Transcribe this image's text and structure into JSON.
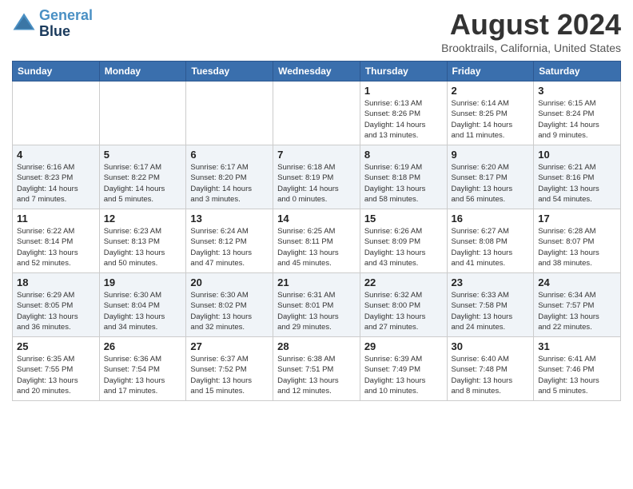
{
  "header": {
    "logo_line1": "General",
    "logo_line2": "Blue",
    "main_title": "August 2024",
    "subtitle": "Brooktrails, California, United States"
  },
  "weekdays": [
    "Sunday",
    "Monday",
    "Tuesday",
    "Wednesday",
    "Thursday",
    "Friday",
    "Saturday"
  ],
  "weeks": [
    [
      {
        "day": "",
        "info": ""
      },
      {
        "day": "",
        "info": ""
      },
      {
        "day": "",
        "info": ""
      },
      {
        "day": "",
        "info": ""
      },
      {
        "day": "1",
        "info": "Sunrise: 6:13 AM\nSunset: 8:26 PM\nDaylight: 14 hours\nand 13 minutes."
      },
      {
        "day": "2",
        "info": "Sunrise: 6:14 AM\nSunset: 8:25 PM\nDaylight: 14 hours\nand 11 minutes."
      },
      {
        "day": "3",
        "info": "Sunrise: 6:15 AM\nSunset: 8:24 PM\nDaylight: 14 hours\nand 9 minutes."
      }
    ],
    [
      {
        "day": "4",
        "info": "Sunrise: 6:16 AM\nSunset: 8:23 PM\nDaylight: 14 hours\nand 7 minutes."
      },
      {
        "day": "5",
        "info": "Sunrise: 6:17 AM\nSunset: 8:22 PM\nDaylight: 14 hours\nand 5 minutes."
      },
      {
        "day": "6",
        "info": "Sunrise: 6:17 AM\nSunset: 8:20 PM\nDaylight: 14 hours\nand 3 minutes."
      },
      {
        "day": "7",
        "info": "Sunrise: 6:18 AM\nSunset: 8:19 PM\nDaylight: 14 hours\nand 0 minutes."
      },
      {
        "day": "8",
        "info": "Sunrise: 6:19 AM\nSunset: 8:18 PM\nDaylight: 13 hours\nand 58 minutes."
      },
      {
        "day": "9",
        "info": "Sunrise: 6:20 AM\nSunset: 8:17 PM\nDaylight: 13 hours\nand 56 minutes."
      },
      {
        "day": "10",
        "info": "Sunrise: 6:21 AM\nSunset: 8:16 PM\nDaylight: 13 hours\nand 54 minutes."
      }
    ],
    [
      {
        "day": "11",
        "info": "Sunrise: 6:22 AM\nSunset: 8:14 PM\nDaylight: 13 hours\nand 52 minutes."
      },
      {
        "day": "12",
        "info": "Sunrise: 6:23 AM\nSunset: 8:13 PM\nDaylight: 13 hours\nand 50 minutes."
      },
      {
        "day": "13",
        "info": "Sunrise: 6:24 AM\nSunset: 8:12 PM\nDaylight: 13 hours\nand 47 minutes."
      },
      {
        "day": "14",
        "info": "Sunrise: 6:25 AM\nSunset: 8:11 PM\nDaylight: 13 hours\nand 45 minutes."
      },
      {
        "day": "15",
        "info": "Sunrise: 6:26 AM\nSunset: 8:09 PM\nDaylight: 13 hours\nand 43 minutes."
      },
      {
        "day": "16",
        "info": "Sunrise: 6:27 AM\nSunset: 8:08 PM\nDaylight: 13 hours\nand 41 minutes."
      },
      {
        "day": "17",
        "info": "Sunrise: 6:28 AM\nSunset: 8:07 PM\nDaylight: 13 hours\nand 38 minutes."
      }
    ],
    [
      {
        "day": "18",
        "info": "Sunrise: 6:29 AM\nSunset: 8:05 PM\nDaylight: 13 hours\nand 36 minutes."
      },
      {
        "day": "19",
        "info": "Sunrise: 6:30 AM\nSunset: 8:04 PM\nDaylight: 13 hours\nand 34 minutes."
      },
      {
        "day": "20",
        "info": "Sunrise: 6:30 AM\nSunset: 8:02 PM\nDaylight: 13 hours\nand 32 minutes."
      },
      {
        "day": "21",
        "info": "Sunrise: 6:31 AM\nSunset: 8:01 PM\nDaylight: 13 hours\nand 29 minutes."
      },
      {
        "day": "22",
        "info": "Sunrise: 6:32 AM\nSunset: 8:00 PM\nDaylight: 13 hours\nand 27 minutes."
      },
      {
        "day": "23",
        "info": "Sunrise: 6:33 AM\nSunset: 7:58 PM\nDaylight: 13 hours\nand 24 minutes."
      },
      {
        "day": "24",
        "info": "Sunrise: 6:34 AM\nSunset: 7:57 PM\nDaylight: 13 hours\nand 22 minutes."
      }
    ],
    [
      {
        "day": "25",
        "info": "Sunrise: 6:35 AM\nSunset: 7:55 PM\nDaylight: 13 hours\nand 20 minutes."
      },
      {
        "day": "26",
        "info": "Sunrise: 6:36 AM\nSunset: 7:54 PM\nDaylight: 13 hours\nand 17 minutes."
      },
      {
        "day": "27",
        "info": "Sunrise: 6:37 AM\nSunset: 7:52 PM\nDaylight: 13 hours\nand 15 minutes."
      },
      {
        "day": "28",
        "info": "Sunrise: 6:38 AM\nSunset: 7:51 PM\nDaylight: 13 hours\nand 12 minutes."
      },
      {
        "day": "29",
        "info": "Sunrise: 6:39 AM\nSunset: 7:49 PM\nDaylight: 13 hours\nand 10 minutes."
      },
      {
        "day": "30",
        "info": "Sunrise: 6:40 AM\nSunset: 7:48 PM\nDaylight: 13 hours\nand 8 minutes."
      },
      {
        "day": "31",
        "info": "Sunrise: 6:41 AM\nSunset: 7:46 PM\nDaylight: 13 hours\nand 5 minutes."
      }
    ]
  ]
}
